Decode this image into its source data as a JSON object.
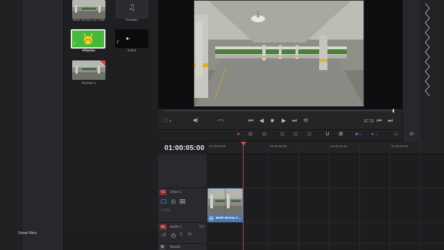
{
  "left_panel": {
    "smart_bins_label": "Smart Bins"
  },
  "media_pool": {
    "clips": [
      {
        "name": "Multi-Storey Car Park",
        "kind": "video",
        "selected": false
      },
      {
        "name": "PacMan",
        "kind": "audio",
        "selected": false
      },
      {
        "name": "Pikachu",
        "kind": "image",
        "selected": true
      },
      {
        "name": "Robot",
        "kind": "image",
        "selected": false
      },
      {
        "name": "Timeline 1",
        "kind": "timeline",
        "selected": false
      }
    ]
  },
  "transport": {
    "nav_dots": "‹ • ›",
    "controls": [
      "skip-to-start-icon",
      "step-back-icon",
      "stop-icon",
      "play-icon",
      "skip-to-end-icon",
      "loop-icon"
    ]
  },
  "timeline": {
    "timecode": "01:00:05:00",
    "ruler_labels": [
      "01:00:00:00",
      "01:00:08:08",
      "01:00:16:16",
      "01:00:25:00"
    ],
    "tracks": [
      {
        "badge": "V1",
        "name": "Video 1",
        "sub": "1 Clip",
        "badge_color": "#8a2e2e"
      },
      {
        "badge": "A1",
        "name": "Audio 1",
        "level": "2.0",
        "badge_color": "#8a2e2e"
      },
      {
        "badge": "M",
        "name": "Master",
        "badge_color": "#3a3a3e"
      }
    ],
    "clip_name": "Multi-Storey C..."
  },
  "colors": {
    "accent_blue": "#2f6fd6",
    "playhead_red": "#e04545",
    "selected_green": "#47b83b",
    "clip_blue": "#4679ad"
  }
}
